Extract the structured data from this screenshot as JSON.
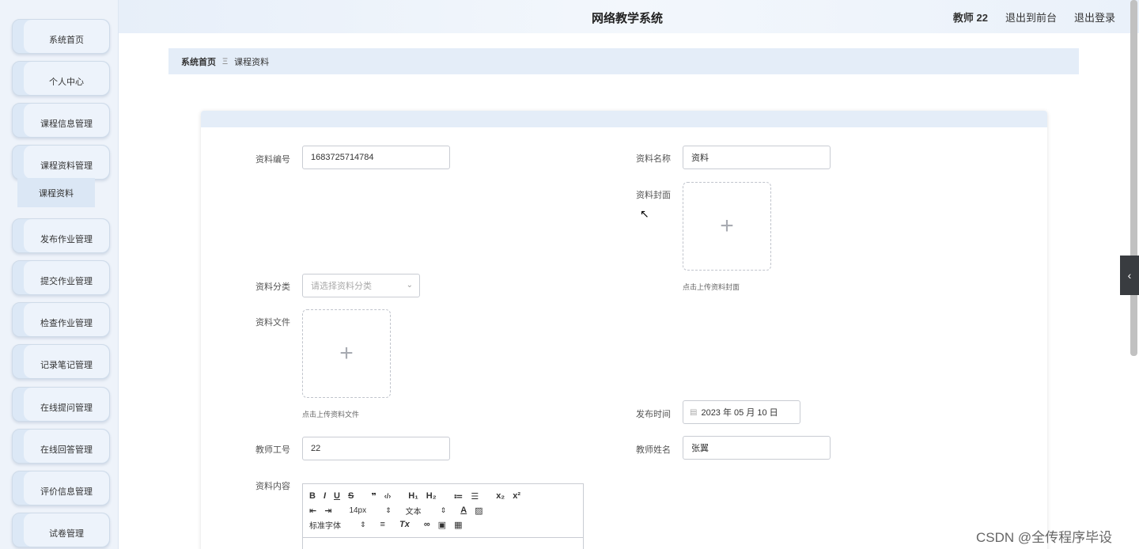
{
  "header": {
    "title": "网络教学系统",
    "user": "教师 22",
    "back_front": "退出到前台",
    "logout": "退出登录"
  },
  "sidebar": {
    "items": [
      {
        "label": "系统首页"
      },
      {
        "label": "个人中心"
      },
      {
        "label": "课程信息管理"
      },
      {
        "label": "课程资料管理"
      },
      {
        "label": "发布作业管理"
      },
      {
        "label": "提交作业管理"
      },
      {
        "label": "检查作业管理"
      },
      {
        "label": "记录笔记管理"
      },
      {
        "label": "在线提问管理"
      },
      {
        "label": "在线回答管理"
      },
      {
        "label": "评价信息管理"
      },
      {
        "label": "试卷管理"
      }
    ],
    "sub_item": "课程资料"
  },
  "breadcrumb": {
    "home": "系统首页",
    "sep": "Ξ",
    "current": "课程资料"
  },
  "form": {
    "code_label": "资料编号",
    "code_value": "1683725714784",
    "name_label": "资料名称",
    "name_value": "资料",
    "cover_label": "资料封面",
    "cover_hint": "点击上传资料封面",
    "category_label": "资料分类",
    "category_placeholder": "请选择资料分类",
    "file_label": "资料文件",
    "file_hint": "点击上传资料文件",
    "publish_label": "发布时间",
    "publish_value": "2023 年 05 月 10 日",
    "teacher_no_label": "教师工号",
    "teacher_no_value": "22",
    "teacher_name_label": "教师姓名",
    "teacher_name_value": "张翼",
    "content_label": "资料内容"
  },
  "editor": {
    "row1": [
      "B",
      "I",
      "U",
      "S",
      "❞",
      "‹/›",
      "H₁",
      "H₂",
      "≔",
      "☰",
      "x₂",
      "x²"
    ],
    "font_size": "14px",
    "text_type": "文本",
    "font_family": "标准字体"
  },
  "watermark": "CSDN @全传程序毕设"
}
